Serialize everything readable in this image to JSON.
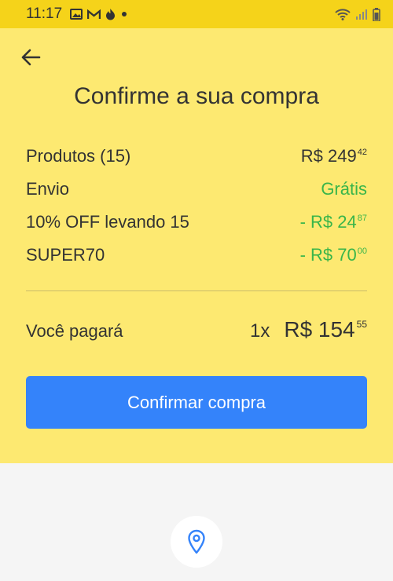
{
  "status_bar": {
    "time": "11:17",
    "left_icons": [
      "image-icon",
      "gmail-icon",
      "flame-icon",
      "dot-icon"
    ],
    "right_icons": [
      "wifi-icon",
      "signal-icon",
      "battery-icon"
    ]
  },
  "page": {
    "title": "Confirme a sua compra",
    "back_icon": "arrow-left-icon"
  },
  "summary": {
    "products": {
      "label": "Produtos (15)",
      "amount": "R$ 249",
      "cents": "42"
    },
    "shipping": {
      "label": "Envio",
      "value": "Grátis"
    },
    "discount": {
      "label": "10% OFF levando 15",
      "amount": "- R$ 24",
      "cents": "87"
    },
    "coupon": {
      "label": "SUPER70",
      "amount": "- R$ 70",
      "cents": "00"
    }
  },
  "total": {
    "label": "Você pagará",
    "installments": "1x",
    "amount": "R$ 154",
    "cents": "55"
  },
  "confirm_button": {
    "label": "Confirmar compra"
  },
  "location": {
    "icon": "location-pin-icon"
  },
  "colors": {
    "status_bar": "#f5d31a",
    "panel": "#fde971",
    "button": "#3483fa",
    "green": "#39b54a",
    "text": "#333333"
  }
}
